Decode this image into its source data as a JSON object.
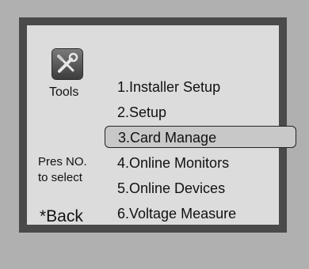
{
  "sidebar": {
    "icon": "tools-icon",
    "label": "Tools",
    "hint_line1": "Pres NO.",
    "hint_line2": "to select",
    "back_label": "*Back"
  },
  "menu": {
    "selected_index": 2,
    "items": [
      {
        "label": "1.Installer Setup"
      },
      {
        "label": "2.Setup"
      },
      {
        "label": "3.Card Manage"
      },
      {
        "label": "4.Online Monitors"
      },
      {
        "label": "5.Online Devices"
      },
      {
        "label": "6.Voltage Measure"
      }
    ]
  },
  "colors": {
    "screen_bg": "#dcdcdc",
    "frame": "#4a4a4a",
    "device": "#b0b0b0",
    "text": "#111111"
  }
}
